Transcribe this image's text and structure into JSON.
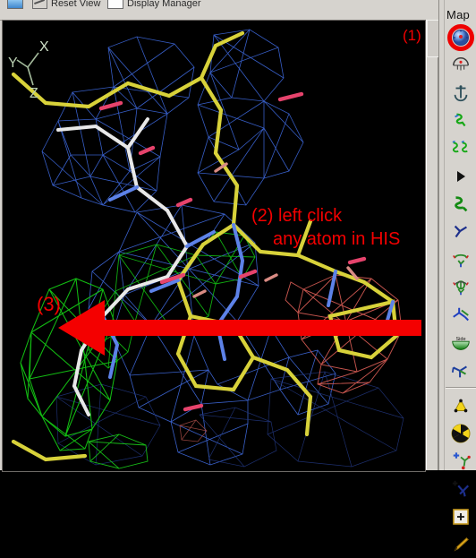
{
  "window": {
    "toolbar_items": [
      {
        "label": "",
        "icon": "window-icon"
      },
      {
        "label": "Reset View",
        "icon": "reset-view-icon"
      },
      {
        "label": "Display Manager",
        "icon": "display-manager-icon"
      }
    ]
  },
  "viewport": {
    "name": "molecular-graphics-viewport",
    "background": "#000000",
    "axis_indicator": {
      "x": "X",
      "y": "Y",
      "z": "Z",
      "color": "#a8bda0"
    },
    "map_colors": {
      "2fofc": "#4169d8",
      "positive_difference": "#17c017",
      "negative_difference": "#c45b55",
      "carbon_yellow": "#d8d23a",
      "carbon_white": "#e6e6e6",
      "oxygen_red": "#e03c64",
      "nitrogen_blue": "#5a7fe0"
    },
    "annotations": [
      {
        "id": "1",
        "text": "(1)",
        "color": "#f40000"
      },
      {
        "id": "2",
        "text": "(2) left click",
        "text2": "any atom in HIS",
        "color": "#f40000"
      },
      {
        "id": "3",
        "text": "(3)",
        "color": "#f40000"
      }
    ],
    "arrow": {
      "name": "red-pointer-arrow",
      "color": "#f40000",
      "direction": "left"
    }
  },
  "sidebar": {
    "title": "Map",
    "highlight_color": "#ee0000",
    "items": [
      {
        "label": "",
        "icon": "sphere-map-icon",
        "highlighted": true
      },
      {
        "label": "",
        "icon": "sphere-outline-icon",
        "highlighted": false
      },
      {
        "label": "",
        "icon": "anchor-icon",
        "highlighted": false
      },
      {
        "label": "",
        "icon": "green-chain-icon",
        "highlighted": false
      },
      {
        "label": "",
        "icon": "double-chain-icon",
        "highlighted": false
      },
      {
        "label": "",
        "icon": "play-triangle-icon",
        "highlighted": false
      },
      {
        "label": "",
        "icon": "green-fragment-icon",
        "highlighted": false
      },
      {
        "label": "",
        "icon": "blue-fragment-icon",
        "highlighted": false
      },
      {
        "label": "",
        "icon": "rotamer-icon",
        "highlighted": false
      },
      {
        "label": "",
        "icon": "rotate-bond-icon",
        "highlighted": false
      },
      {
        "label": "",
        "icon": "torsion-icon",
        "highlighted": false
      },
      {
        "label": "Side",
        "icon": "side-chain-icon",
        "highlighted": false
      },
      {
        "label": "",
        "icon": "fit-residue-icon",
        "highlighted": false
      },
      {
        "label": "",
        "icon": "divider",
        "highlighted": false
      },
      {
        "label": "",
        "icon": "triangle-atoms-icon",
        "highlighted": false
      },
      {
        "label": "",
        "icon": "radiation-icon",
        "highlighted": false
      },
      {
        "label": "",
        "icon": "add-atom-icon",
        "highlighted": false
      },
      {
        "label": "",
        "icon": "add-bond-icon",
        "highlighted": false
      },
      {
        "label": "",
        "icon": "plus-box-icon",
        "highlighted": false
      },
      {
        "label": "",
        "icon": "pencil-icon",
        "highlighted": false
      }
    ]
  }
}
